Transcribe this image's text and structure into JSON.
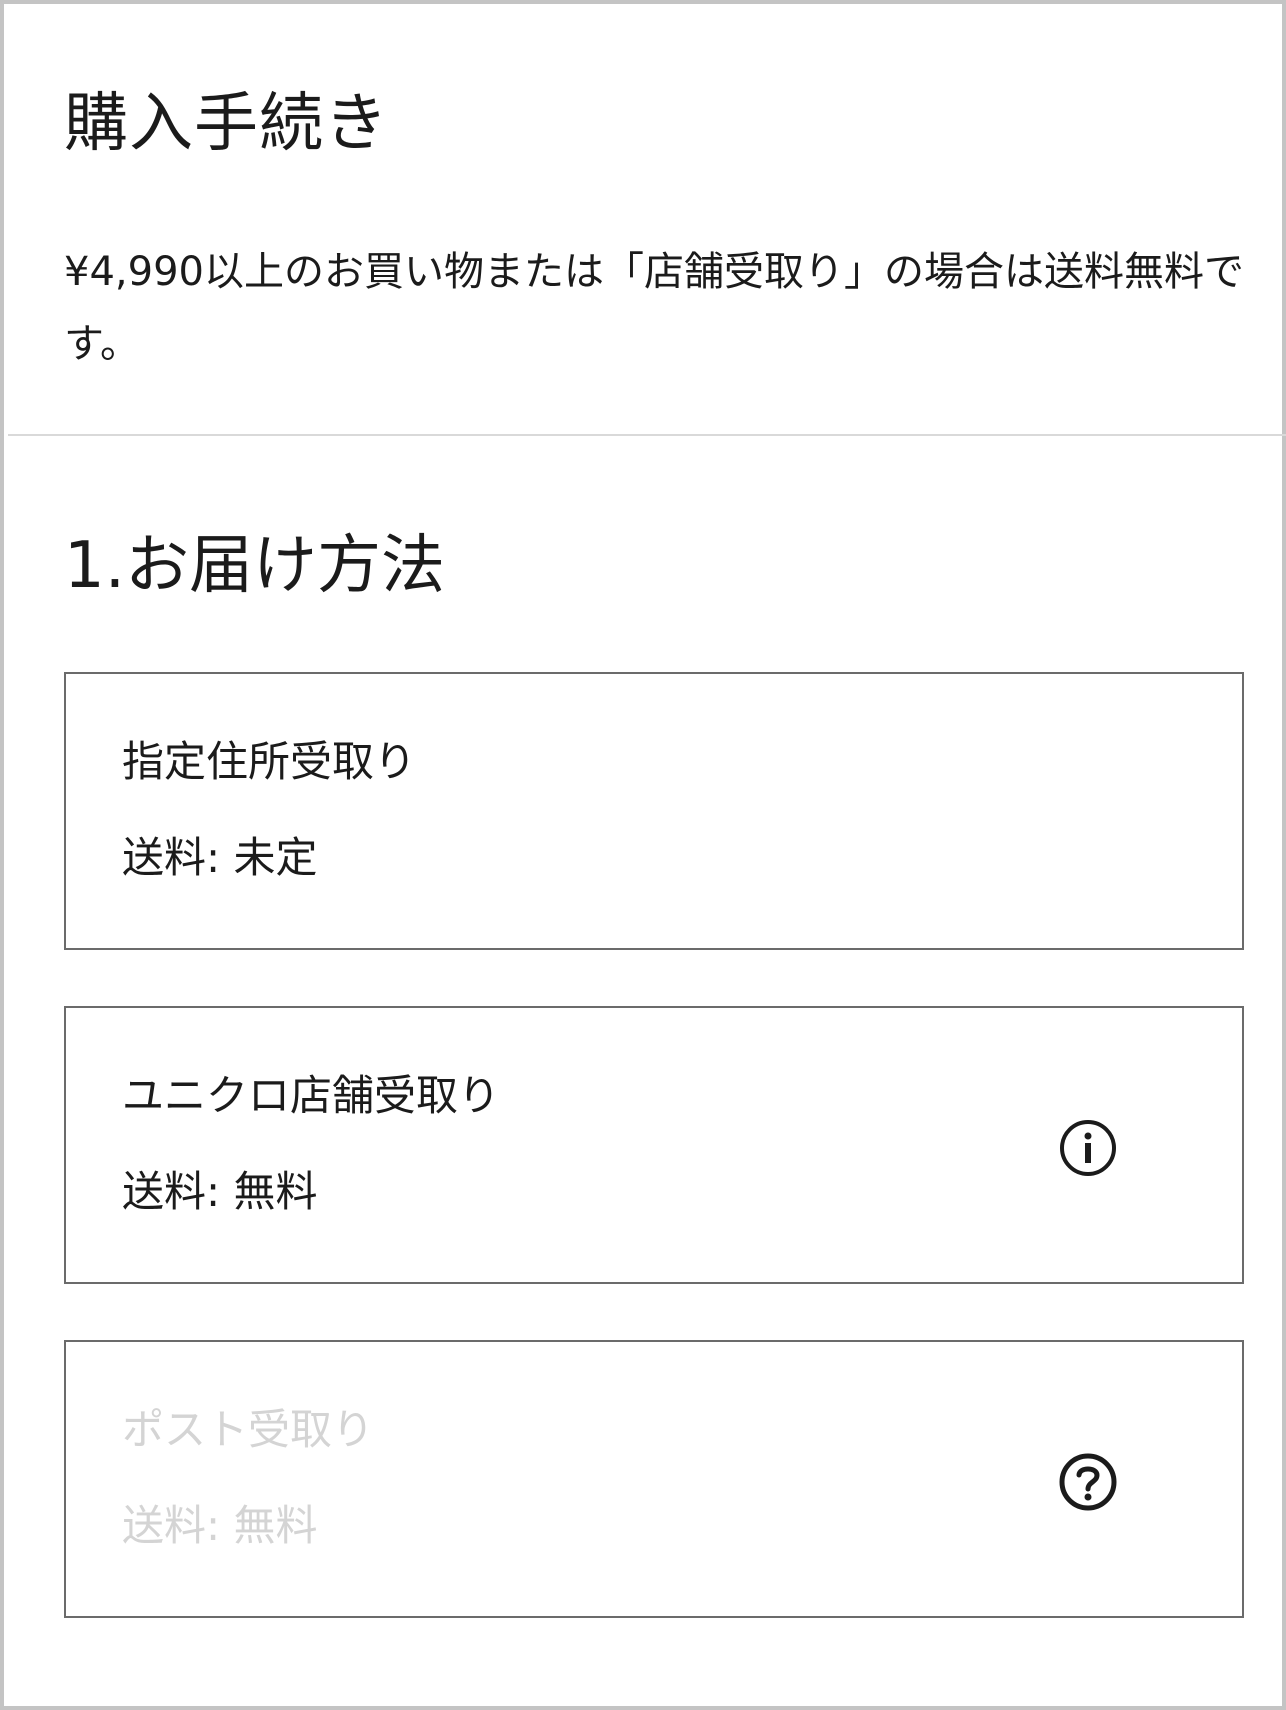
{
  "header": {
    "title": "購入手続き",
    "notice": "¥4,990以上のお買い物または「店舗受取り」の場合は送料無料です。"
  },
  "delivery": {
    "section_title": "1.お届け方法",
    "options": [
      {
        "label": "指定住所受取り",
        "fee": "送料: 未定",
        "enabled": true,
        "icon": null
      },
      {
        "label": "ユニクロ店舗受取り",
        "fee": "送料: 無料",
        "enabled": true,
        "icon": "info-icon"
      },
      {
        "label": "ポスト受取り",
        "fee": "送料: 無料",
        "enabled": false,
        "icon": "help-icon"
      }
    ]
  },
  "colors": {
    "text": "#1b1b1b",
    "disabled_text": "#d4d4d4",
    "card_border": "#6b6b6b",
    "divider": "#d9d9d9",
    "frame_border": "#c4c4c4"
  }
}
